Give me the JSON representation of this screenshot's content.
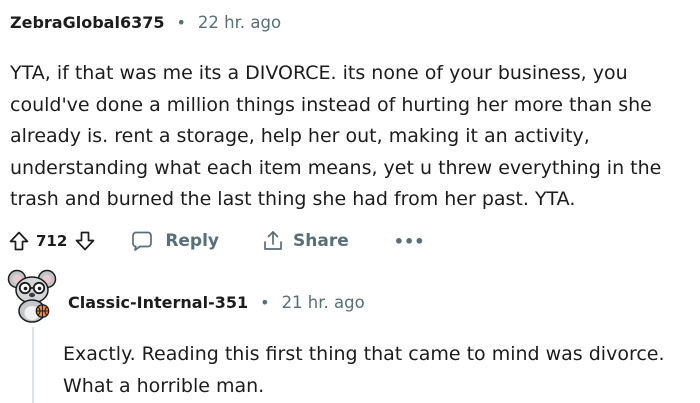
{
  "comment": {
    "author": "ZebraGlobal6375",
    "separator": "•",
    "time": "22 hr. ago",
    "body": "YTA, if that was me its a DIVORCE. its none of your business, you\ncould've done a million things instead of hurting her more than she\nalready is. rent a storage, help her out, making it an activity,\nunderstanding what each item means, yet u threw everything in the\ntrash and burned the last thing she had from her past. YTA.",
    "votes": "712",
    "reply_label": "Reply",
    "share_label": "Share",
    "more_label": "•••",
    "icons": {
      "upvote": "upvote-arrow-icon",
      "downvote": "downvote-arrow-icon",
      "reply": "speech-bubble-icon",
      "share": "share-icon",
      "more": "more-options-icon"
    }
  },
  "reply": {
    "author": "Classic-Internal-351",
    "separator": "•",
    "time": "21 hr. ago",
    "body": "Exactly. Reading this first thing that came to mind was divorce.\nWhat a horrible man.",
    "avatar_icon": "koala-avatar-icon"
  },
  "colors": {
    "text": "#1c1c1c",
    "muted": "#576f76",
    "thread_line": "#dfe3e6"
  }
}
